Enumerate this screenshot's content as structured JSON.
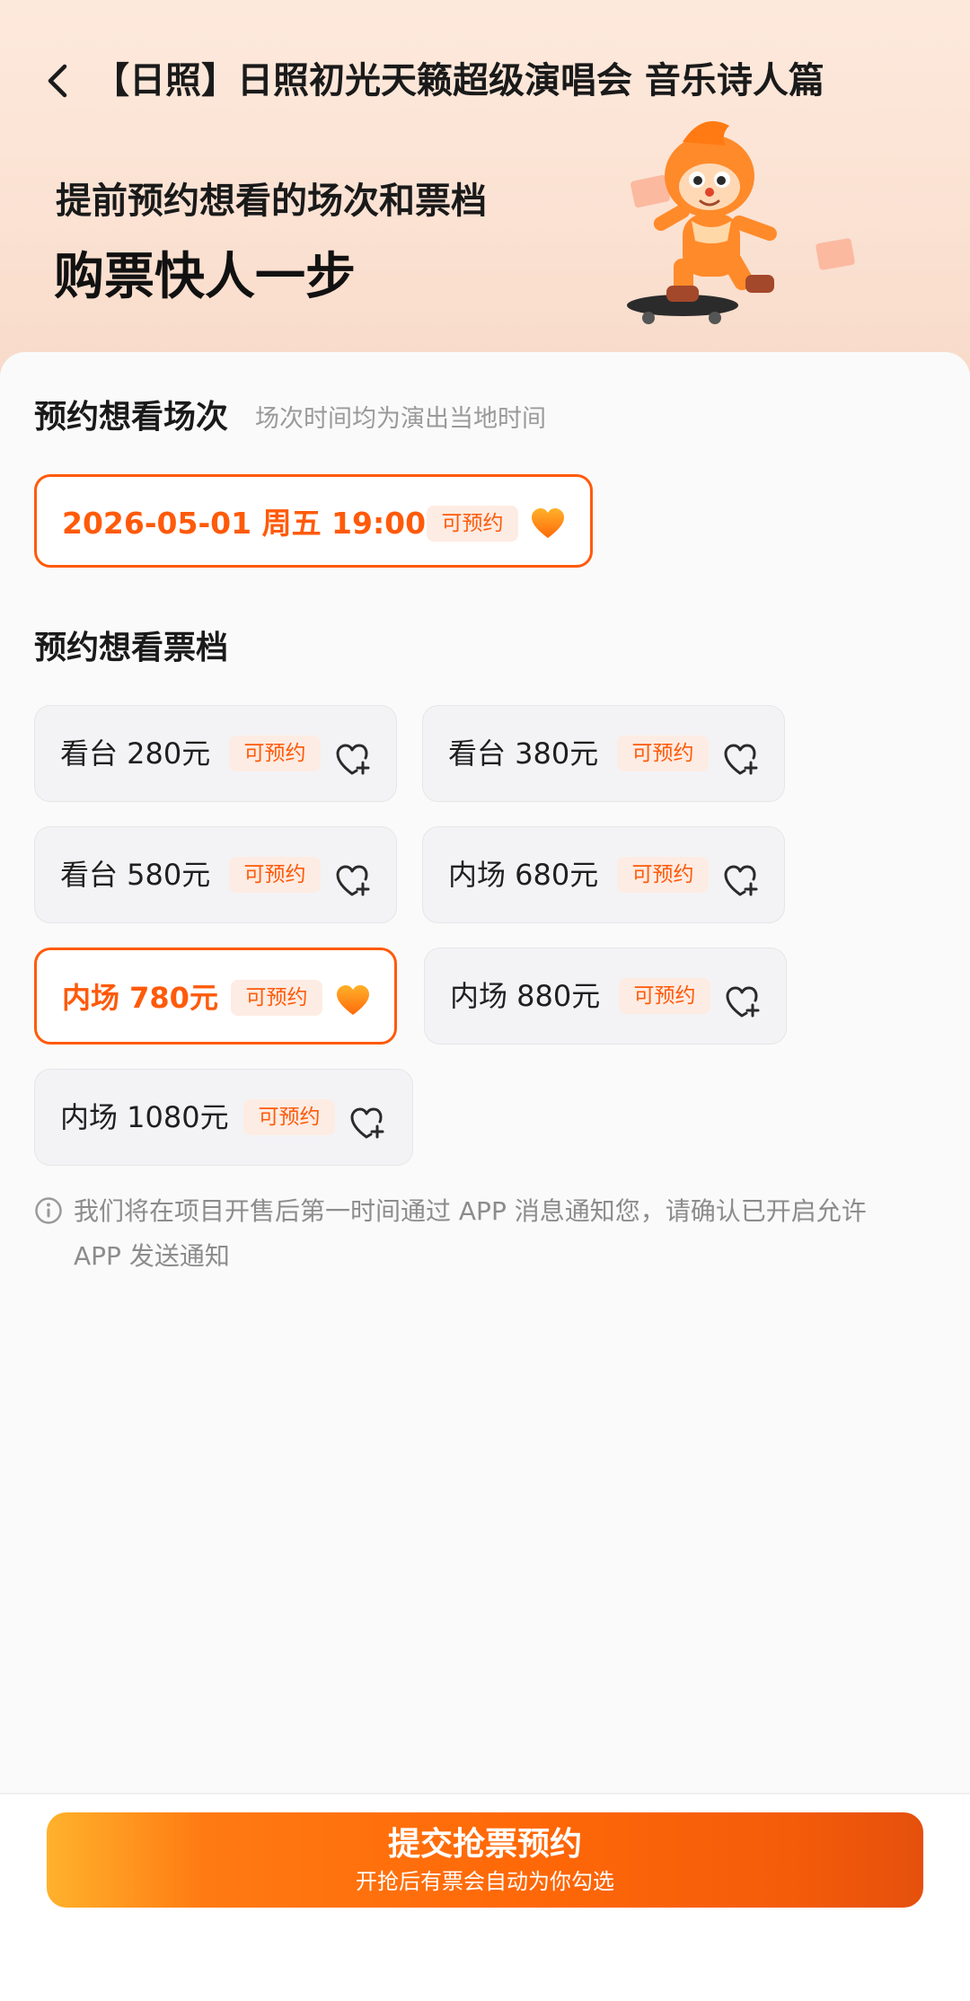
{
  "header": {
    "title": "【日照】日照初光天籁超级演唱会 音乐诗人篇",
    "slogan_line1": "提前预约想看的场次和票档",
    "slogan_line2": "购票快人一步"
  },
  "session_section": {
    "title": "预约想看场次",
    "note": "场次时间均为演出当地时间",
    "sessions": [
      {
        "label": "2026-05-01  周五 19:00",
        "tag": "可预约",
        "selected": true
      }
    ]
  },
  "tier_section": {
    "title": "预约想看票档",
    "tiers": [
      {
        "label": "看台 280元",
        "tag": "可预约",
        "selected": false
      },
      {
        "label": "看台 380元",
        "tag": "可预约",
        "selected": false
      },
      {
        "label": "看台 580元",
        "tag": "可预约",
        "selected": false
      },
      {
        "label": "内场 680元",
        "tag": "可预约",
        "selected": false
      },
      {
        "label": "内场 780元",
        "tag": "可预约",
        "selected": true
      },
      {
        "label": "内场 880元",
        "tag": "可预约",
        "selected": false
      },
      {
        "label": "内场 1080元",
        "tag": "可预约",
        "selected": false
      }
    ]
  },
  "notice": "我们将在项目开售后第一时间通过 APP 消息通知您，请确认已开启允许 APP 发送通知",
  "submit": {
    "label": "提交抢票预约",
    "sublabel": "开抢后有票会自动为你勾选"
  },
  "colors": {
    "accent": "#ff5a0a",
    "tag_bg": "#fdece3",
    "card_bg": "#fafafa",
    "tier_bg": "#f3f3f5"
  }
}
